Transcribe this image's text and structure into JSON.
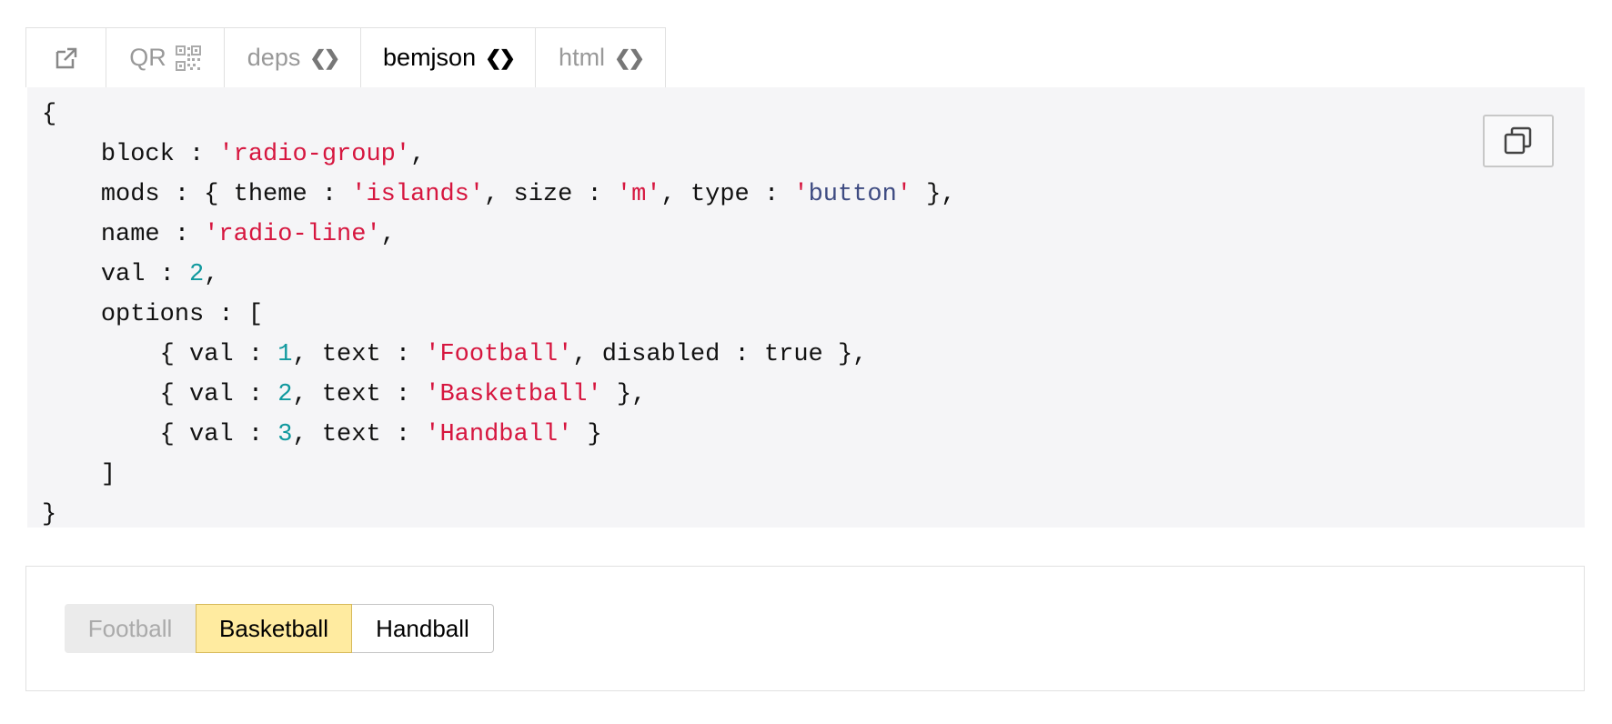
{
  "tabs": {
    "qr": "QR",
    "deps": "deps",
    "bemjson": "bemjson",
    "html": "html",
    "arrows": "<>",
    "active": "bemjson"
  },
  "code": {
    "open_brace": "{",
    "close_brace": "}",
    "block_key": "block",
    "block_val": "'radio-group'",
    "mods_key": "mods",
    "theme_key": "theme",
    "theme_val": "'islands'",
    "size_key": "size",
    "size_val": "'m'",
    "type_key": "type",
    "type_val": "'button'",
    "name_key": "name",
    "name_val": "'radio-line'",
    "val_key": "val",
    "val_val": "2",
    "options_key": "options",
    "opt1_val": "1",
    "opt1_text": "'Football'",
    "disabled_key": "disabled",
    "disabled_val": "true",
    "opt2_val": "2",
    "opt2_text": "'Basketball'",
    "opt3_val": "3",
    "opt3_text": "'Handball'",
    "text_key": "text",
    "close_bracket": "]"
  },
  "radio_group": {
    "options": [
      {
        "text": "Football",
        "disabled": true,
        "checked": false
      },
      {
        "text": "Basketball",
        "disabled": false,
        "checked": true
      },
      {
        "text": "Handball",
        "disabled": false,
        "checked": false
      }
    ]
  },
  "colors": {
    "string": "#d6163f",
    "number": "#11999e",
    "keyword": "#3e4b82",
    "checked_bg": "#ffeba0",
    "code_bg": "#f5f5f7"
  },
  "icons": {
    "open": "external-link-icon",
    "qr": "qr-code-icon",
    "copy": "copy-icon"
  }
}
